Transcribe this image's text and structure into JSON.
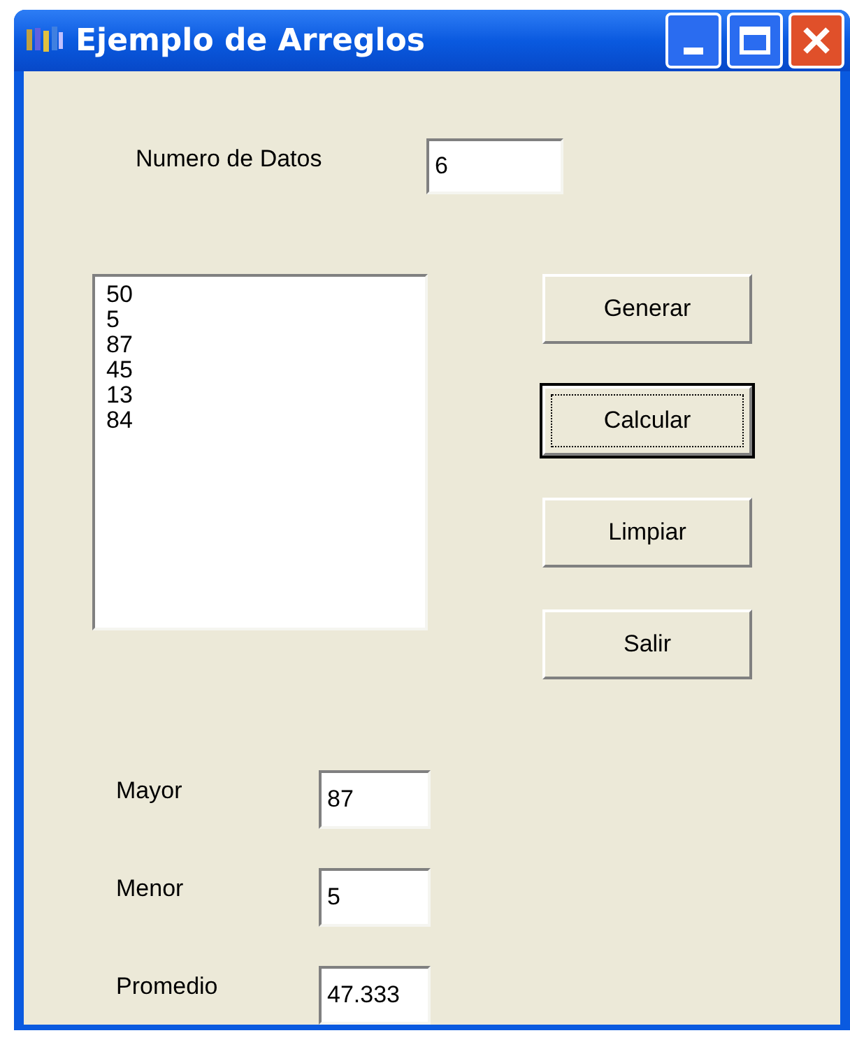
{
  "window": {
    "title": "Ejemplo de Arreglos"
  },
  "count": {
    "label": "Numero de Datos",
    "value": "6"
  },
  "list": {
    "items": [
      "50",
      "5",
      "87",
      "45",
      "13",
      "84"
    ]
  },
  "buttons": [
    {
      "label": "Generar",
      "focused": false
    },
    {
      "label": "Calcular",
      "focused": true
    },
    {
      "label": "Limpiar",
      "focused": false
    },
    {
      "label": "Salir",
      "focused": false
    }
  ],
  "results": [
    {
      "label": "Mayor",
      "value": "87"
    },
    {
      "label": "Menor",
      "value": "5"
    },
    {
      "label": "Promedio",
      "value": "47.333"
    }
  ]
}
